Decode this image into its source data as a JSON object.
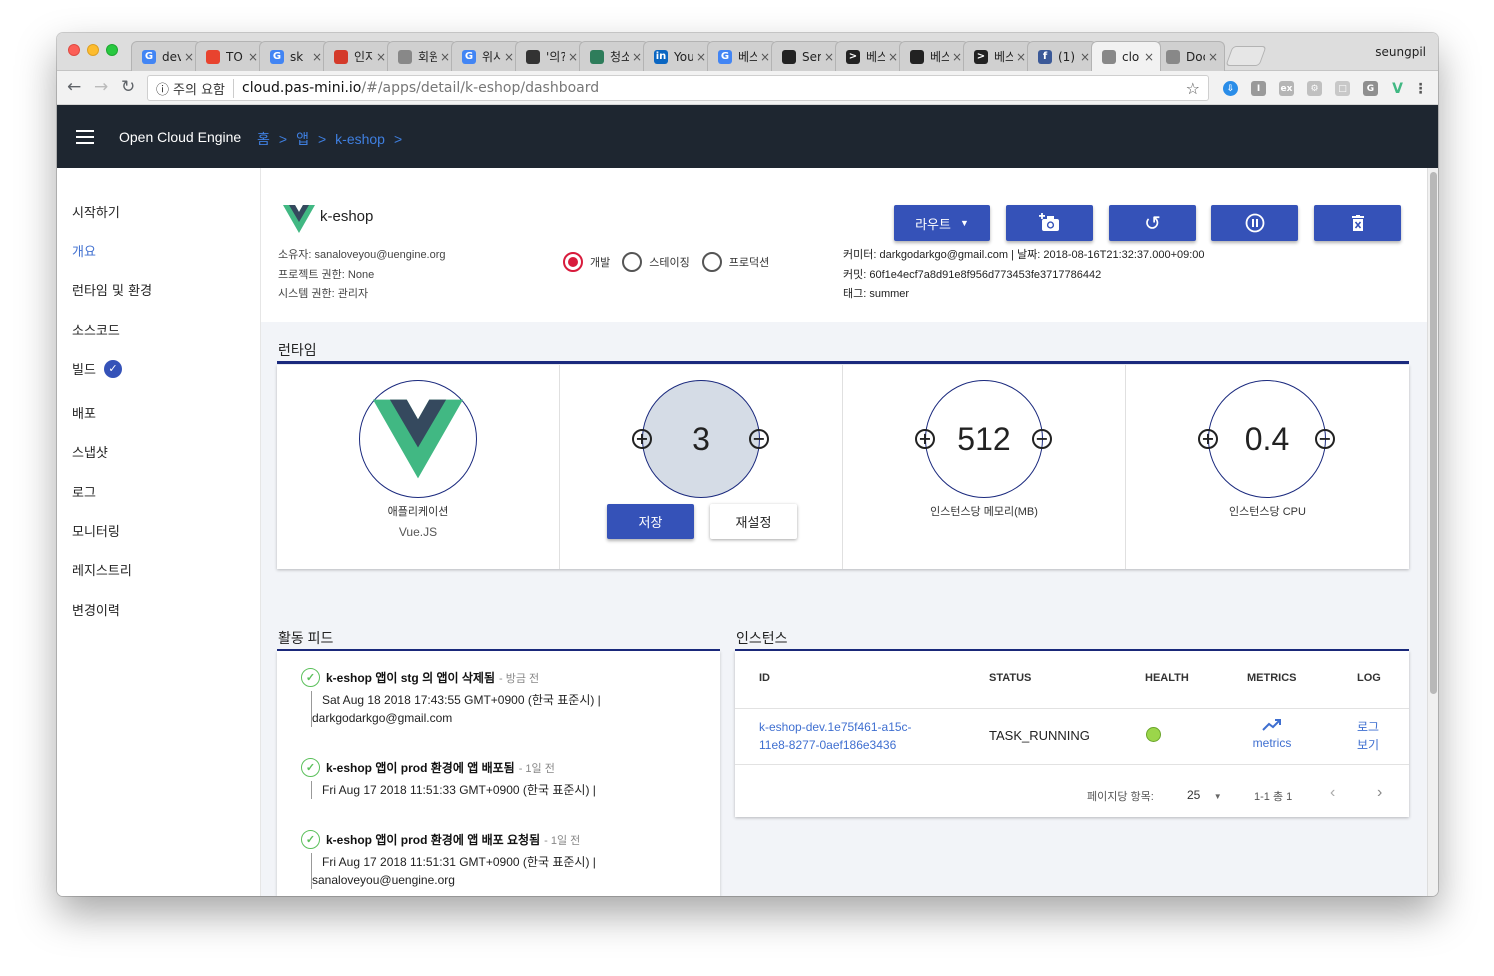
{
  "browser": {
    "tabs": [
      {
        "label": "dev",
        "icon": "google-icon",
        "color": "#4285f4",
        "glyph": "G"
      },
      {
        "label": "TO",
        "icon": "red-bar-icon",
        "color": "#e8432e",
        "glyph": ""
      },
      {
        "label": "sk",
        "icon": "google-icon",
        "color": "#4285f4",
        "glyph": "G"
      },
      {
        "label": "인지",
        "icon": "red-flag-icon",
        "color": "#d43a2a",
        "glyph": ""
      },
      {
        "label": "회원",
        "icon": "page-icon",
        "color": "#888888",
        "glyph": ""
      },
      {
        "label": "위시",
        "icon": "google-icon",
        "color": "#4285f4",
        "glyph": "G"
      },
      {
        "label": "'의?",
        "icon": "keyboard-icon",
        "color": "#333333",
        "glyph": ""
      },
      {
        "label": "청소",
        "icon": "hexagon-icon",
        "color": "#2e7d5b",
        "glyph": ""
      },
      {
        "label": "You",
        "icon": "linkedin-icon",
        "color": "#0a66c2",
        "glyph": "in"
      },
      {
        "label": "베스",
        "icon": "google-icon",
        "color": "#4285f4",
        "glyph": "G"
      },
      {
        "label": "Ser",
        "icon": "cloud-icon",
        "color": "#222222",
        "glyph": ""
      },
      {
        "label": "베스",
        "icon": "chevron-app-icon",
        "color": "#222222",
        "glyph": ">"
      },
      {
        "label": "베스",
        "icon": "cloud-icon",
        "color": "#222222",
        "glyph": ""
      },
      {
        "label": "베스",
        "icon": "chevron-app-icon",
        "color": "#222222",
        "glyph": ">"
      },
      {
        "label": "(1)",
        "icon": "facebook-icon",
        "color": "#3b5998",
        "glyph": "f"
      },
      {
        "label": "clo",
        "icon": "page-icon",
        "color": "#888888",
        "glyph": "",
        "active": true
      },
      {
        "label": "Doc",
        "icon": "page-icon",
        "color": "#888888",
        "glyph": ""
      }
    ],
    "tab_close": "×",
    "profile": "seungpil",
    "security_warning": "주의 요함",
    "url_host": "cloud.pas-mini.io",
    "url_path": "/#/apps/detail/k-eshop/dashboard"
  },
  "header": {
    "app_name": "Open Cloud Engine",
    "breadcrumbs": [
      "홈",
      ">",
      "앱",
      ">",
      "k-eshop",
      ">"
    ]
  },
  "sidebar": {
    "items": [
      {
        "label": "시작하기"
      },
      {
        "label": "개요",
        "active": true
      },
      {
        "label": "런타임 및 환경"
      },
      {
        "label": "소스코드"
      },
      {
        "label": "빌드",
        "badge": "check"
      },
      {
        "label": "배포"
      },
      {
        "label": "스냅샷"
      },
      {
        "label": "로그"
      },
      {
        "label": "모니터링"
      },
      {
        "label": "레지스트리"
      },
      {
        "label": "변경이력"
      }
    ]
  },
  "app": {
    "title": "k-eshop",
    "owner": "소유자: sanaloveyou@uengine.org",
    "project_permission": "프로젝트 권한: None",
    "system_permission": "시스템 권한: 관리자",
    "stages": [
      {
        "label": "개발",
        "selected": true
      },
      {
        "label": "스테이징",
        "selected": false
      },
      {
        "label": "프로덕션",
        "selected": false
      }
    ],
    "committer": "커미터: darkgodarkgo@gmail.com | 날짜: 2018-08-16T21:32:37.000+09:00",
    "commit": "커밋: 60f1e4ecf7a8d91e8f956d773453fe3717786442",
    "tag": "태그: summer",
    "route_button": "라우트",
    "accent": "#3552b8"
  },
  "runtime": {
    "section_title": "런타임",
    "app_type_label": "애플리케이션",
    "app_framework": "Vue.JS",
    "instances": "3",
    "save_button": "저장",
    "reset_button": "재설정",
    "memory": "512",
    "memory_label": "인스턴스당 메모리(MB)",
    "cpu": "0.4",
    "cpu_label": "인스턴스당 CPU",
    "plus": "+",
    "minus": "−"
  },
  "feed": {
    "section_title": "활동 피드",
    "items": [
      {
        "title": "k-eshop 앱이 stg 의 앱이 삭제됨",
        "ago": "- 방금 전",
        "line": "Sat Aug 18 2018 17:43:55 GMT+0900 (한국 표준시) |",
        "user": "darkgodarkgo@gmail.com"
      },
      {
        "title": "k-eshop 앱이 prod 환경에 앱 배포됨",
        "ago": "- 1일 전",
        "line": "Fri Aug 17 2018 11:51:33 GMT+0900 (한국 표준시) |",
        "user": ""
      },
      {
        "title": "k-eshop 앱이 prod 환경에 앱 배포 요청됨",
        "ago": "- 1일 전",
        "line": "Fri Aug 17 2018 11:51:31 GMT+0900 (한국 표준시) |",
        "user": "sanaloveyou@uengine.org"
      }
    ]
  },
  "instances": {
    "section_title": "인스턴스",
    "columns": [
      "ID",
      "STATUS",
      "HEALTH",
      "METRICS",
      "LOG"
    ],
    "rows": [
      {
        "id_line1": "k-eshop-dev.1e75f461-a15c-",
        "id_line2": "11e8-8277-0aef186e3436",
        "status": "TASK_RUNNING",
        "health": "healthy",
        "metrics": "metrics",
        "log_line1": "로그",
        "log_line2": "보기"
      }
    ],
    "per_page_label": "페이지당 항목:",
    "per_page": "25",
    "range": "1-1 총 1"
  }
}
